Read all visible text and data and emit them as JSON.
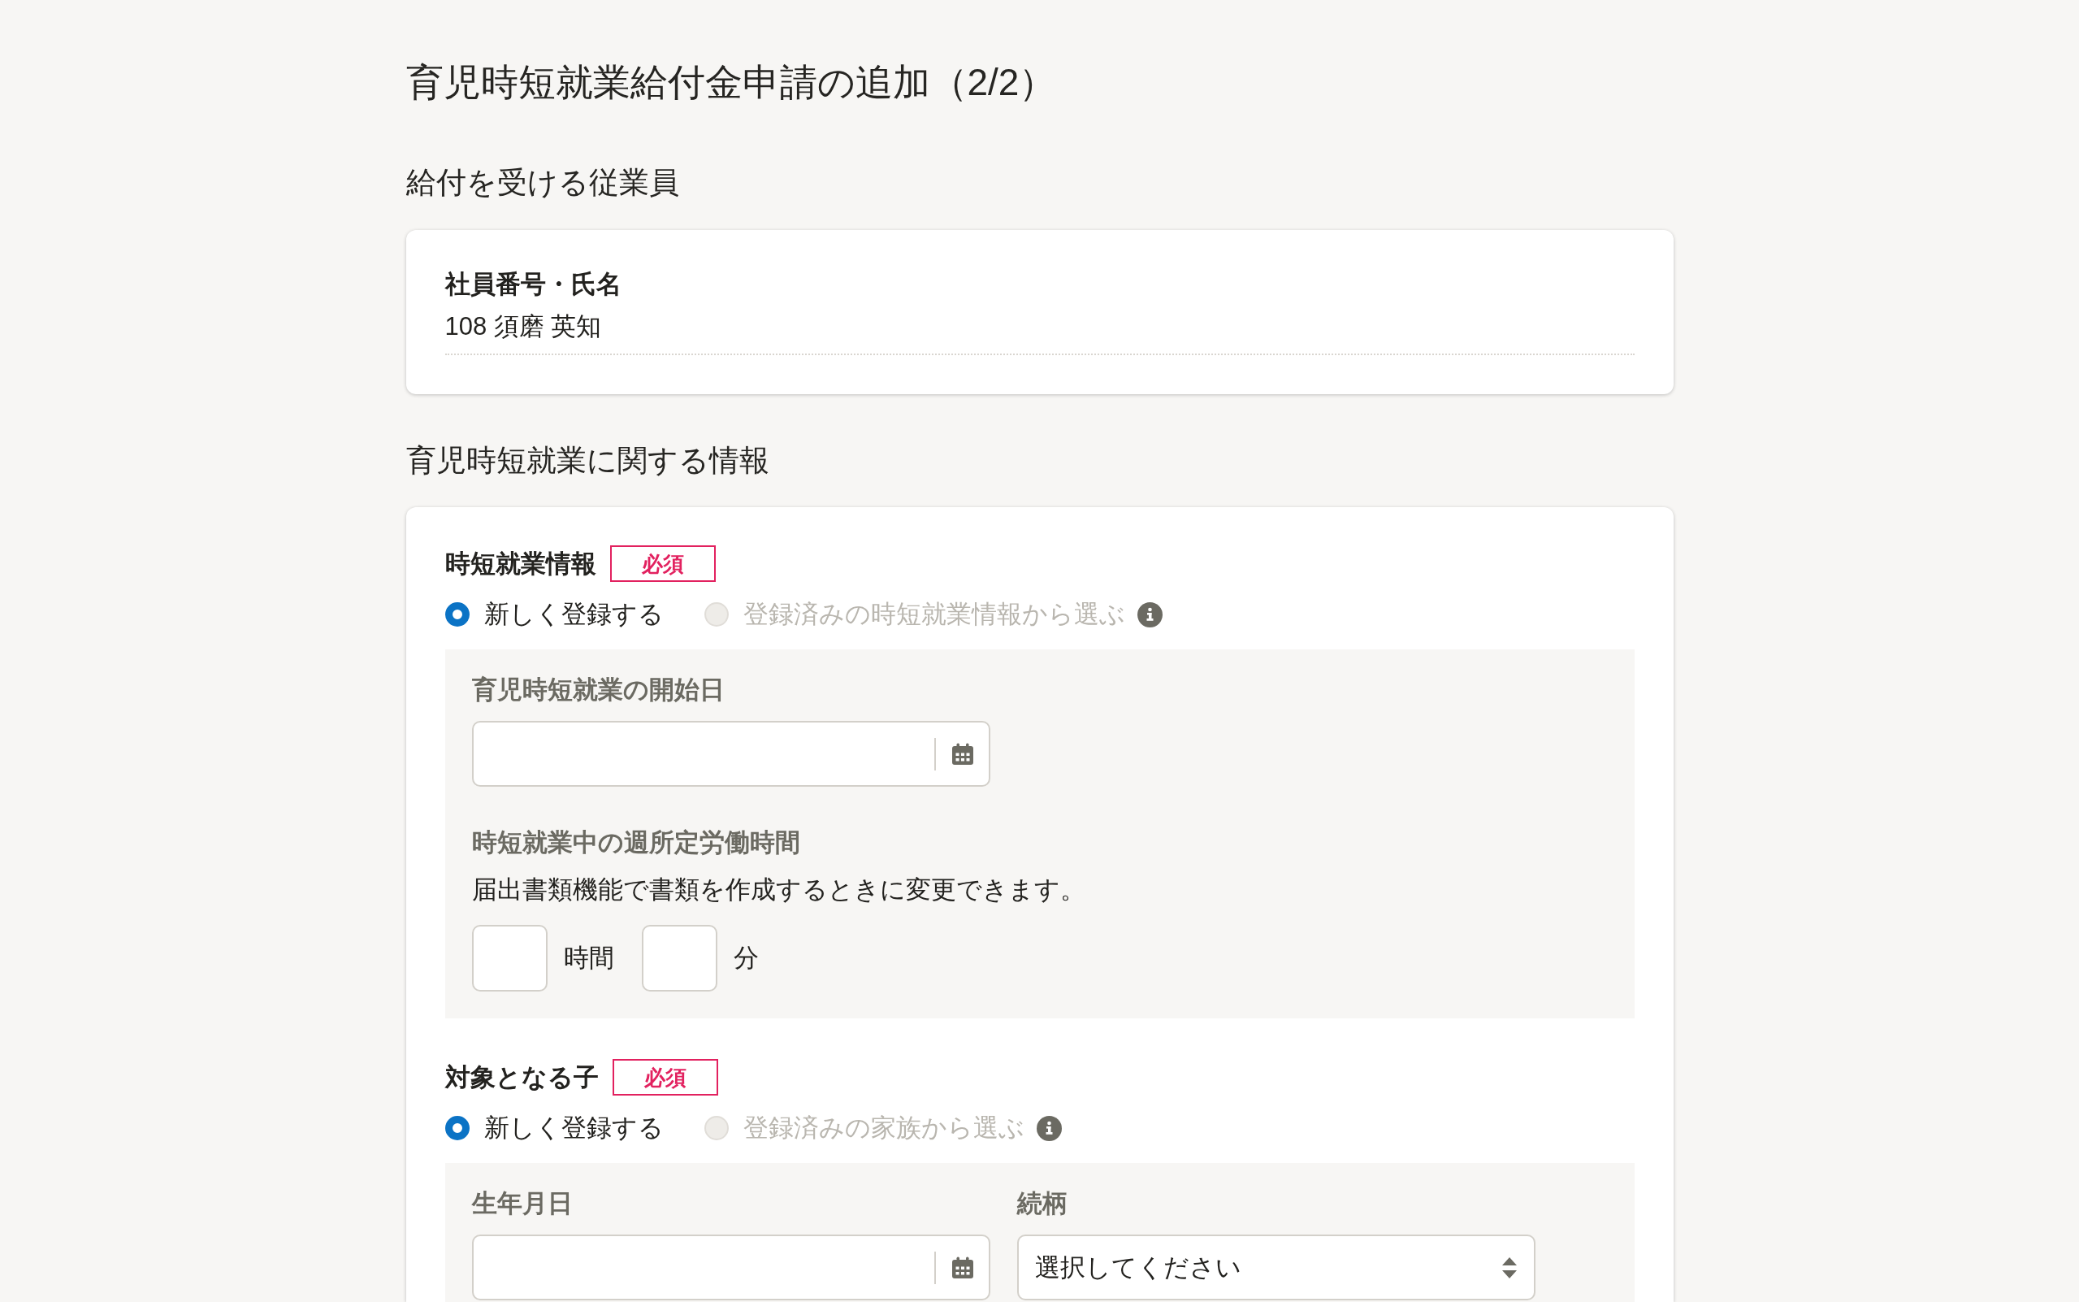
{
  "page": {
    "title": "育児時短就業給付金申請の追加（2/2）"
  },
  "sections": [
    {
      "heading": "給付を受ける従業員",
      "kind": "summary",
      "fields": [
        {
          "label": "社員番号・氏名",
          "value": "108 須磨 英知"
        }
      ]
    },
    {
      "heading": "育児時短就業に関する情報",
      "kind": "form",
      "groups": [
        {
          "label": "時短就業情報",
          "badge": "必須",
          "options": [
            {
              "label": "新しく登録する",
              "selected": true,
              "disabled": false
            },
            {
              "label": "登録済みの時短就業情報から選ぶ",
              "selected": false,
              "disabled": true
            }
          ],
          "fields": [
            {
              "kind": "date",
              "label": "育児時短就業の開始日"
            },
            {
              "kind": "duration",
              "label": "時短就業中の週所定労働時間",
              "help": "届出書類機能で書類を作成するときに変更できます。",
              "units": [
                "時間",
                "分"
              ]
            }
          ]
        },
        {
          "label": "対象となる子",
          "badge": "必須",
          "options": [
            {
              "label": "新しく登録する",
              "selected": true,
              "disabled": false
            },
            {
              "label": "登録済みの家族から選ぶ",
              "selected": false,
              "disabled": true
            }
          ],
          "fields": [
            {
              "kind": "date",
              "label": "生年月日"
            },
            {
              "kind": "select",
              "label": "続柄",
              "placeholder": "選択してください"
            }
          ]
        }
      ]
    }
  ]
}
